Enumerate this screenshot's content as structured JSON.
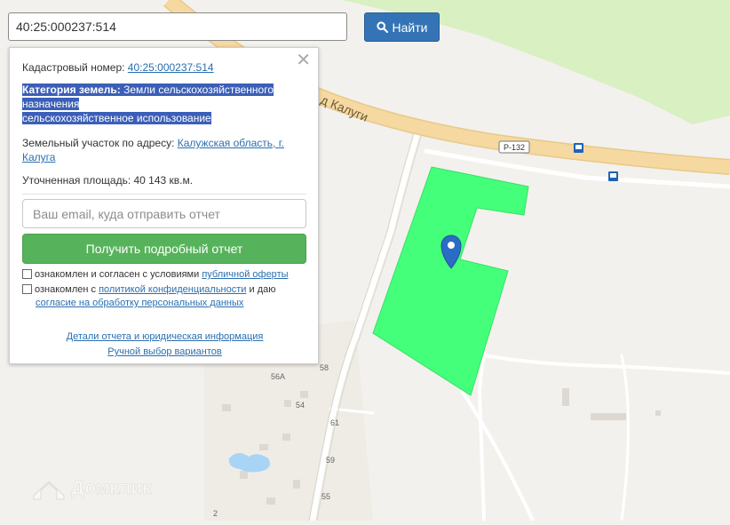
{
  "search": {
    "value": "40:25:000237:514",
    "button_label": "Найти"
  },
  "popup": {
    "cadastral_label": "Кадастровый номер:",
    "cadastral_value": "40:25:000237:514",
    "category_label": "Категория земель:",
    "category_value_1": "Земли сельскохозяйственного",
    "category_value_2": "назначения",
    "category_value_3": "сельскохозяйственное использование",
    "address_label": "Земельный участок по адресу:",
    "address_value_1": "Калужская область, г.",
    "address_value_2": "Калуга",
    "area_label": "Уточненная площадь:",
    "area_value": "40 143 кв.м.",
    "email_placeholder": "Ваш email, куда отправить отчет",
    "report_button": "Получить подробный отчет",
    "consent_1_text": "ознакомлен и согласен с условиями",
    "consent_1_link": "публичной оферты",
    "consent_2_text_a": "ознакомлен с",
    "consent_2_link_a": "политикой конфиденциальности",
    "consent_2_text_b": "и даю",
    "consent_2_link_b": "согласие на обработку персональных данных",
    "details_link": "Детали отчета и юридическая информация",
    "manual_link": "Ручной выбор вариантов"
  },
  "map": {
    "road_label": "д Калуги",
    "route_badge": "Р-132",
    "house_numbers": [
      "58",
      "56А",
      "54",
      "61",
      "59",
      "55",
      "2"
    ],
    "watermark": "Домклик",
    "colors": {
      "parcel": "#44ff7a",
      "road": "#f6d9a0",
      "forest": "#d8f0c2",
      "background": "#f3f1ed"
    }
  }
}
